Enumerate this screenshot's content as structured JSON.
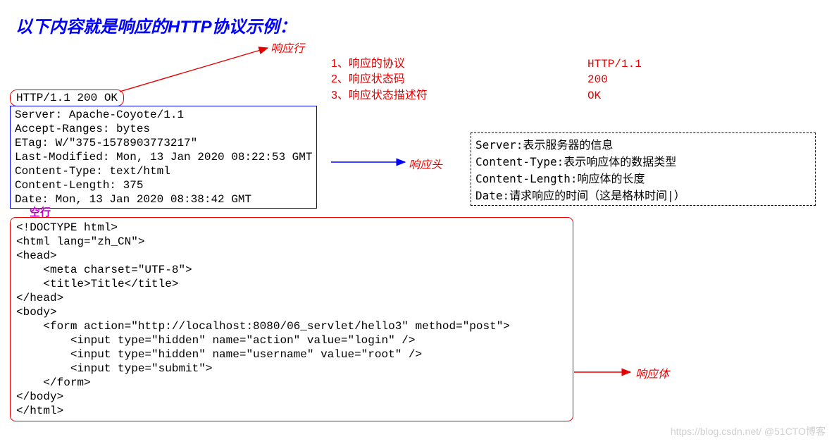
{
  "title": "以下内容就是响应的HTTP协议示例：",
  "labels": {
    "response_line": "响应行",
    "response_header": "响应头",
    "response_body": "响应体",
    "empty_line": "空行"
  },
  "status_line": "HTTP/1.1 200 OK",
  "response_line_items": {
    "i1": "1、响应的协议",
    "i2": "2、响应状态码",
    "i3": "3、响应状态描述符",
    "v1": "HTTP/1.1",
    "v2": "200",
    "v3": "OK"
  },
  "headers_text": "Server: Apache-Coyote/1.1\nAccept-Ranges: bytes\nETag: W/\"375-1578903773217\"\nLast-Modified: Mon, 13 Jan 2020 08:22:53 GMT\nContent-Type: text/html\nContent-Length: 375\nDate: Mon, 13 Jan 2020 08:38:42 GMT",
  "body_text": "<!DOCTYPE html>\n<html lang=\"zh_CN\">\n<head>\n    <meta charset=\"UTF-8\">\n    <title>Title</title>\n</head>\n<body>\n    <form action=\"http://localhost:8080/06_servlet/hello3\" method=\"post\">\n        <input type=\"hidden\" name=\"action\" value=\"login\" />\n        <input type=\"hidden\" name=\"username\" value=\"root\" />\n        <input type=\"submit\">\n    </form>\n</body>\n</html>",
  "explain": {
    "l1": "Server:表示服务器的信息",
    "l2": "Content-Type:表示响应体的数据类型",
    "l3": "Content-Length:响应体的长度",
    "l4": "Date:请求响应的时间（这是格林时间|）"
  },
  "watermark": "https://blog.csdn.net/ @51CTO博客"
}
